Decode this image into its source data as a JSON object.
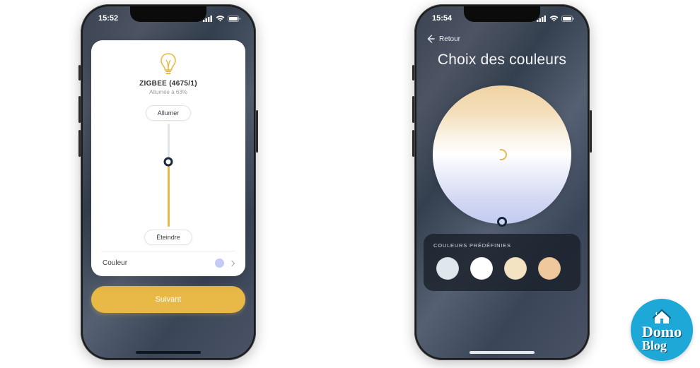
{
  "phone1": {
    "status": {
      "time": "15:52"
    },
    "device": {
      "name": "ZIGBEE (4675/1)",
      "status": "Allumée à 63%",
      "brightness_percent": 63
    },
    "controls": {
      "on_label": "Allumer",
      "off_label": "Éteindre"
    },
    "color_row": {
      "label": "Couleur",
      "current_color": "#c4caf5"
    },
    "primary_button": "Suivant"
  },
  "phone2": {
    "status": {
      "time": "15:54"
    },
    "back_label": "Retour",
    "title": "Choix des couleurs",
    "presets": {
      "heading": "COULEURS PRÉDÉFINIES",
      "swatches": [
        {
          "color": "#dfe6ec"
        },
        {
          "color": "#ffffff"
        },
        {
          "color": "#f3e3c2"
        },
        {
          "color": "#efc89d"
        }
      ]
    }
  },
  "watermark": {
    "line1": "Domo",
    "line2": "Blog"
  }
}
